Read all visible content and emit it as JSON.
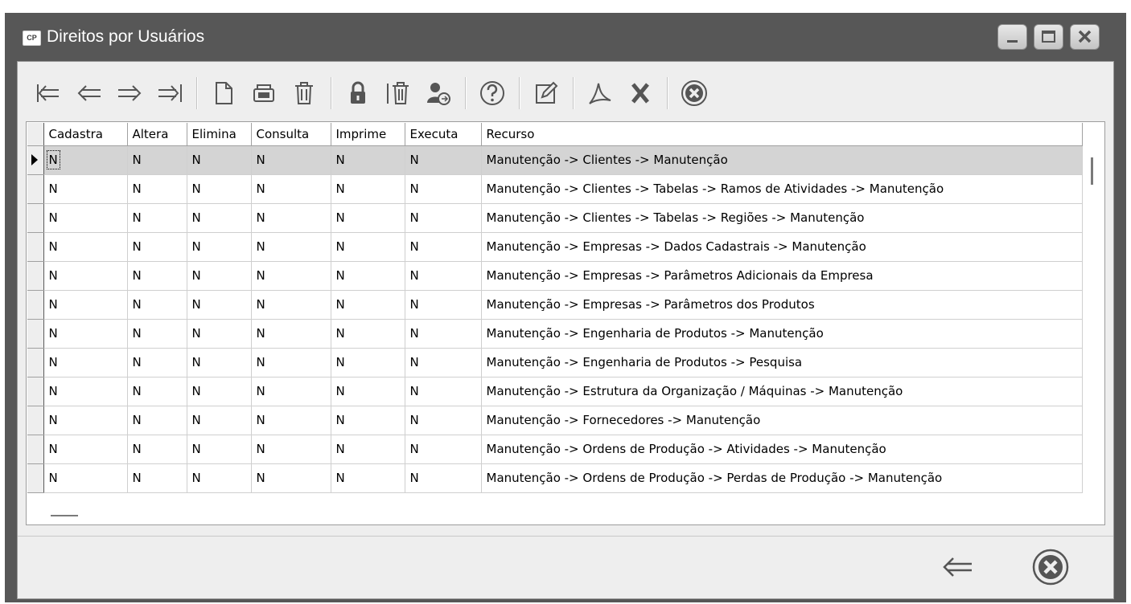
{
  "window": {
    "title": "Direitos por Usuários",
    "app_icon_text": "CP",
    "buttons": [
      "minimize-icon",
      "maximize-icon",
      "close-icon"
    ]
  },
  "toolbar": {
    "icons": [
      "first-record-icon",
      "previous-record-icon",
      "next-record-icon",
      "last-record-icon",
      "new-document-icon",
      "edit-record-icon",
      "delete-icon",
      "lock-icon",
      "delete-all-icon",
      "user-permissions-icon",
      "help-icon",
      "edit-note-icon",
      "pdf-export-icon",
      "excel-export-icon",
      "close-icon"
    ]
  },
  "grid": {
    "columns": [
      "Cadastra",
      "Altera",
      "Elimina",
      "Consulta",
      "Imprime",
      "Executa",
      "Recurso"
    ],
    "selected_row": 0,
    "rows": [
      [
        "N",
        "N",
        "N",
        "N",
        "N",
        "N",
        "Manutenção -> Clientes -> Manutenção"
      ],
      [
        "N",
        "N",
        "N",
        "N",
        "N",
        "N",
        "Manutenção -> Clientes -> Tabelas -> Ramos de Atividades -> Manutenção"
      ],
      [
        "N",
        "N",
        "N",
        "N",
        "N",
        "N",
        "Manutenção -> Clientes -> Tabelas -> Regiões -> Manutenção"
      ],
      [
        "N",
        "N",
        "N",
        "N",
        "N",
        "N",
        "Manutenção -> Empresas -> Dados Cadastrais -> Manutenção"
      ],
      [
        "N",
        "N",
        "N",
        "N",
        "N",
        "N",
        "Manutenção -> Empresas -> Parâmetros Adicionais da Empresa"
      ],
      [
        "N",
        "N",
        "N",
        "N",
        "N",
        "N",
        "Manutenção -> Empresas -> Parâmetros dos Produtos"
      ],
      [
        "N",
        "N",
        "N",
        "N",
        "N",
        "N",
        "Manutenção -> Engenharia de Produtos -> Manutenção"
      ],
      [
        "N",
        "N",
        "N",
        "N",
        "N",
        "N",
        "Manutenção -> Engenharia de Produtos -> Pesquisa"
      ],
      [
        "N",
        "N",
        "N",
        "N",
        "N",
        "N",
        "Manutenção -> Estrutura da Organização / Máquinas -> Manutenção"
      ],
      [
        "N",
        "N",
        "N",
        "N",
        "N",
        "N",
        "Manutenção -> Fornecedores -> Manutenção"
      ],
      [
        "N",
        "N",
        "N",
        "N",
        "N",
        "N",
        "Manutenção -> Ordens de Produção -> Atividades -> Manutenção"
      ],
      [
        "N",
        "N",
        "N",
        "N",
        "N",
        "N",
        "Manutenção -> Ordens de Produção -> Perdas de Produção -> Manutenção"
      ]
    ]
  },
  "footer": {
    "icons": [
      "back-arrow-icon",
      "cancel-icon"
    ]
  }
}
